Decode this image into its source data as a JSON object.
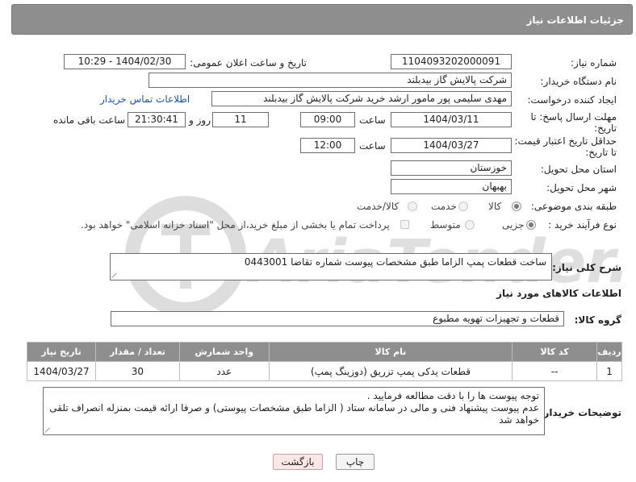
{
  "header": {
    "title": "جزئیات اطلاعات نیاز"
  },
  "fields": {
    "need_number_label": "شماره نیاز:",
    "need_number": "1104093202000091",
    "announce_label": "تاریخ و ساعت اعلان عمومی:",
    "announce_value": "1404/02/30 - 10:29",
    "buyer_org_label": "نام دستگاه خریدار:",
    "buyer_org": "شرکت پالایش گاز بیدبلند",
    "requester_label": "ایجاد کننده درخواست:",
    "requester": "مهدی سلیمی پور مامور ارشد خرید شرکت پالایش گاز بیدبلند",
    "contact_link": "اطلاعات تماس خریدار",
    "reply_deadline_label_1": "مهلت ارسال پاسخ: تا",
    "reply_deadline_label_2": "تاریخ:",
    "reply_date": "1404/03/11",
    "time_label": "ساعت",
    "reply_time": "09:00",
    "days_value": "11",
    "days_label": "روز و",
    "remaining_time": "21:30:41",
    "remaining_label": "ساعت باقی مانده",
    "price_validity_label_1": "حداقل تاریخ اعتبار قیمت:",
    "price_validity_label_2": "تا تاریخ:",
    "price_date": "1404/03/27",
    "price_time": "12:00",
    "province_label": "استان محل تحویل:",
    "province": "خوزستان",
    "city_label": "شهر محل تحویل:",
    "city": "بهبهان",
    "category_label": "طبقه بندی موضوعی:",
    "category_options": [
      "کالا",
      "خدمت",
      "کالا/خدمت"
    ],
    "process_label": "نوع فرآیند خرید :",
    "process_options": [
      "جزیی",
      "متوسط"
    ],
    "payment_note": "پرداخت تمام یا بخشی از مبلغ خرید،از محل \"اسناد خزانه اسلامی\" خواهد بود."
  },
  "description": {
    "label": "شرح کلی نیاز:",
    "text": "ساخت قطعات پمپ الزاما طبق مشخصات پیوست شماره تقاضا 0443001"
  },
  "goods": {
    "section_title": "اطلاعات کالاهای مورد نیاز",
    "group_label": "گروه کالا:",
    "group_value": "قطعات و تجهیزات تهویه مطبوع"
  },
  "table": {
    "headers": [
      "ردیف",
      "کد کالا",
      "نام کالا",
      "واحد شمارش",
      "تعداد / مقدار",
      "تاریخ نیاز"
    ],
    "rows": [
      [
        "1",
        "--",
        "قطعات یدکی پمپ تزریق (دوزینگ پمپ)",
        "عدد",
        "30",
        "1404/03/27"
      ]
    ]
  },
  "buyer_notes": {
    "label": "توضیحات خریدار:",
    "line1": "توجه پیوست ها  را با دقت مطالعه فرمایید .",
    "line2": "عدم پیوست پیشنهاد فنی و مالی در سامانه ستاد ( الزاما طبق مشخصات پیوستی)  و صرفا ارائه قیمت بمنزله انصراف تلقی خواهد شد"
  },
  "buttons": {
    "print": "چاپ",
    "back": "بازگشت"
  },
  "watermark": {
    "text": "AriaTender.neT"
  },
  "colors": {
    "header_bg": "#8e8e8e",
    "link": "#1c55b5",
    "back_button_bg": "#fde6e6"
  }
}
